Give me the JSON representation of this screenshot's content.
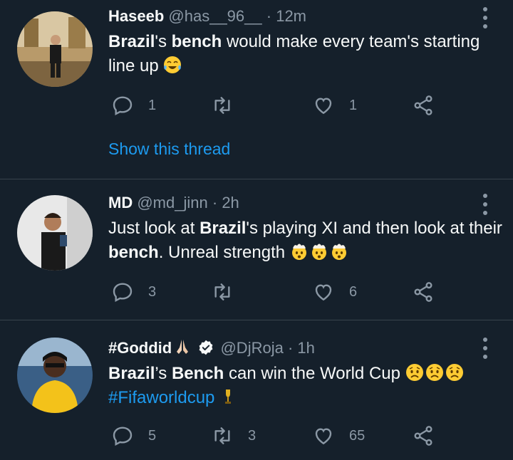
{
  "tweets": [
    {
      "name": "Haseeb",
      "handle": "@has__96__",
      "dot": "·",
      "time": "12m",
      "text": {
        "p1": "Brazil",
        "p2": "'s ",
        "p3": "bench",
        "p4": " would make every team's starting line up "
      },
      "reply_count": "1",
      "retweet_count": "",
      "like_count": "1",
      "show_thread": "Show this thread"
    },
    {
      "name": "MD",
      "handle": "@md_jinn",
      "dot": "·",
      "time": "2h",
      "text": {
        "p1": "Just look at ",
        "p2": "Brazil",
        "p3": "'s playing XI and then look at their ",
        "p4": "bench",
        "p5": ". Unreal strength "
      },
      "reply_count": "3",
      "retweet_count": "",
      "like_count": "6"
    },
    {
      "name": "#Goddid",
      "handle": "@DjRoja",
      "dot": "·",
      "time": "1h",
      "verified": true,
      "text": {
        "p1": "Brazil",
        "p2": "’s ",
        "p3": "Bench",
        "p4": " can win the World Cup ",
        "hashtag": "#Fifaworldcup"
      },
      "reply_count": "5",
      "retweet_count": "3",
      "like_count": "65"
    }
  ],
  "colors": {
    "background": "#15202b",
    "primary_text": "#f7f9f9",
    "secondary_text": "#8b98a5",
    "accent": "#1d9bf0",
    "divider": "#38444d"
  },
  "icons": {
    "reply": "reply-icon",
    "retweet": "retweet-icon",
    "like": "heart-icon",
    "share": "share-icon",
    "more": "more-options-icon",
    "verified": "verified-badge-icon"
  }
}
